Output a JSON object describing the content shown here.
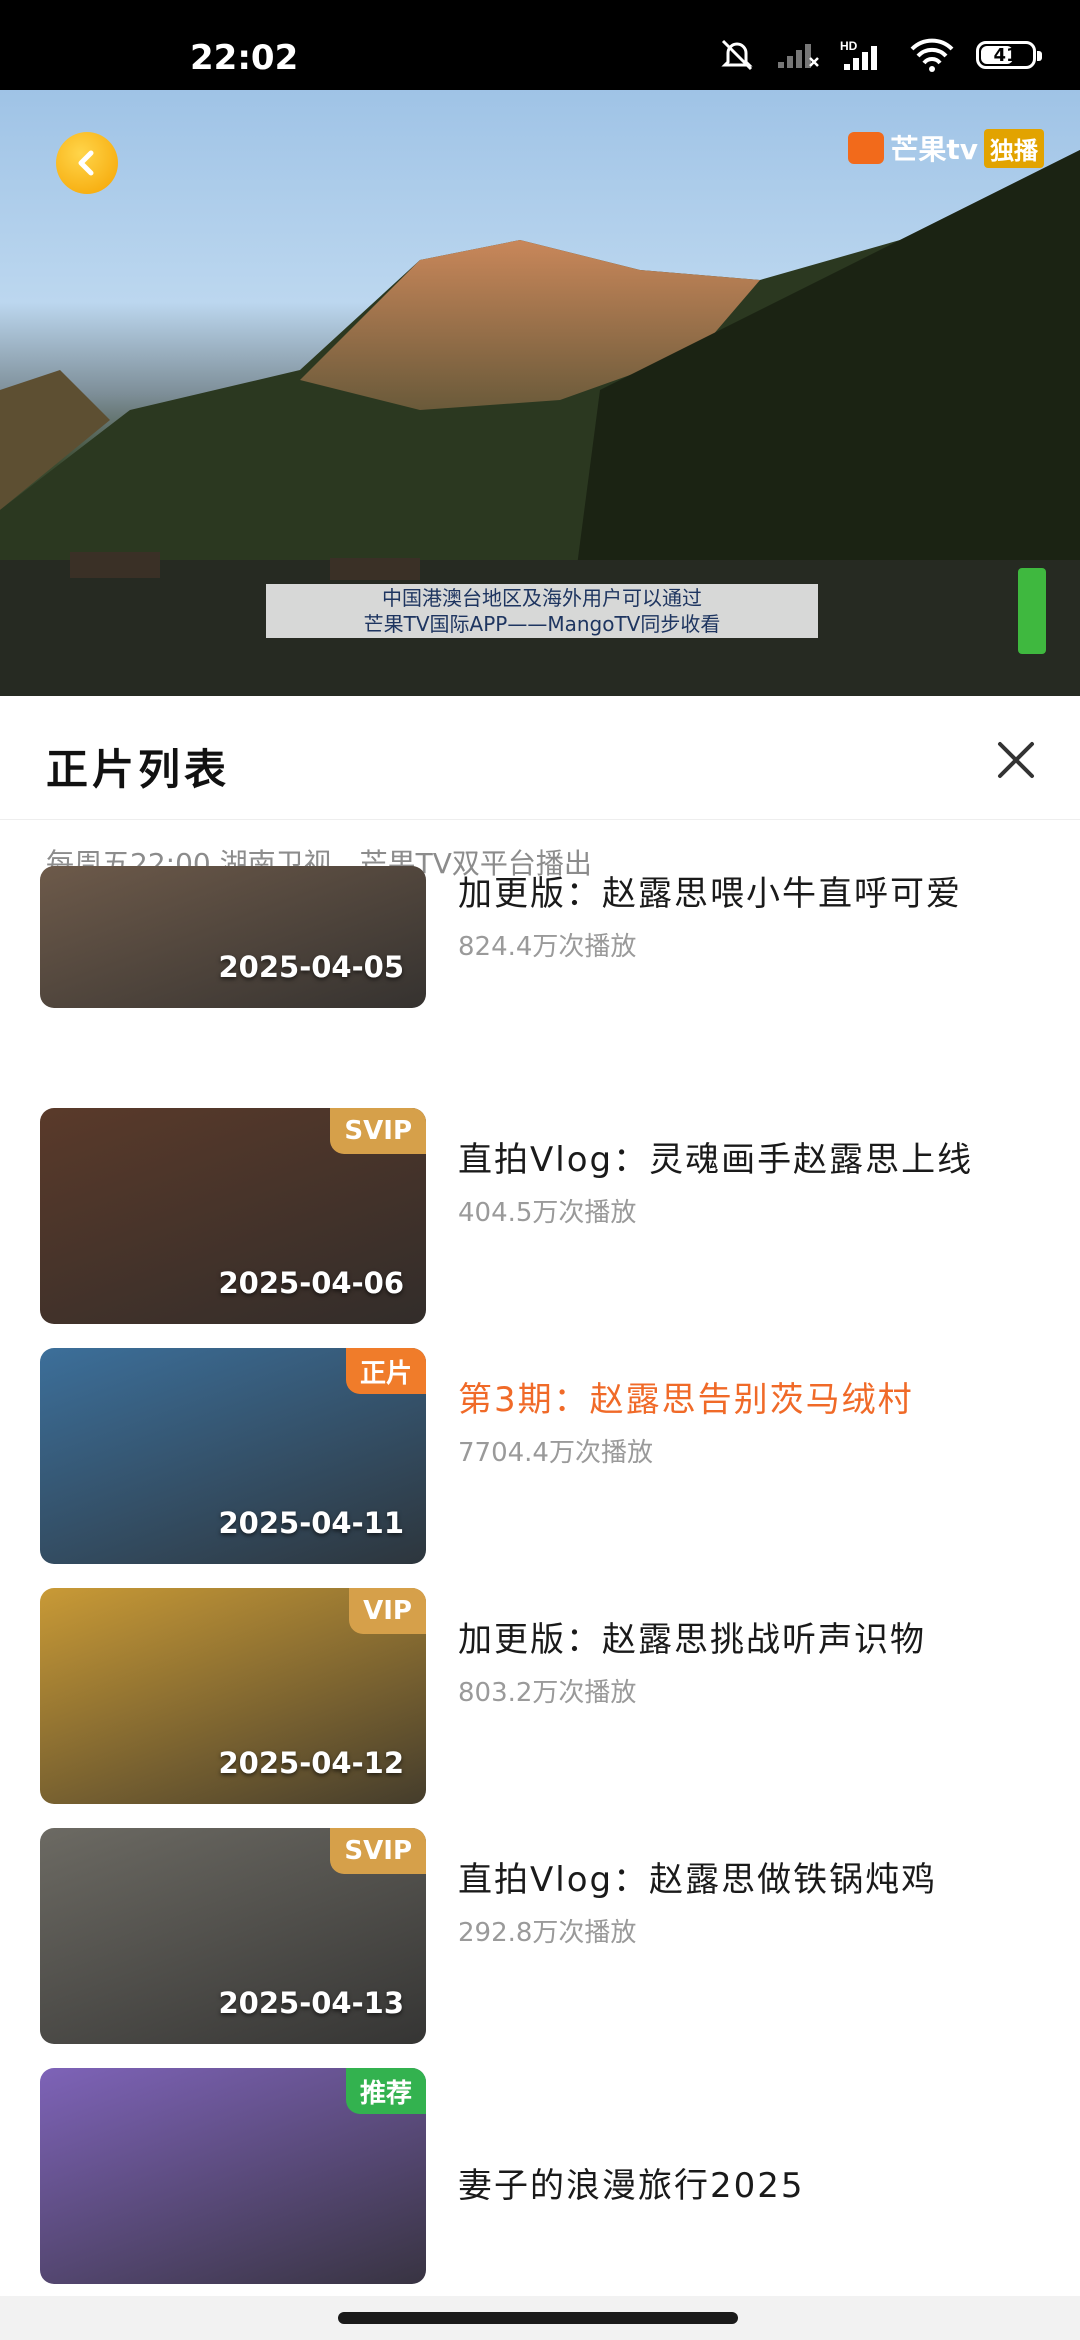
{
  "status_bar": {
    "time": "22:02",
    "network": "HD",
    "wifi_level": "6",
    "battery": "41"
  },
  "player": {
    "channel_logo": "芒果tv",
    "live_badge": "独播",
    "subtitle_line1": "中国港澳台地区及海外用户可以通过",
    "subtitle_line2": "芒果TV国际APP——MangoTV同步收看"
  },
  "sheet": {
    "title": "正片列表",
    "schedule": "每周五22:00 湖南卫视、芒果TV双平台播出"
  },
  "episodes": [
    {
      "date": "2025-04-05",
      "badge": "",
      "badge_color": "",
      "title": "加更版：赵露思喂小牛直呼可爱",
      "plays": "824.4万次播放",
      "active": false,
      "bg": "#6d5a4a"
    },
    {
      "date": "2025-04-06",
      "badge": "SVIP",
      "badge_color": "gold",
      "title": "直拍Vlog：灵魂画手赵露思上线",
      "plays": "404.5万次播放",
      "active": false,
      "bg": "#5a3a2a"
    },
    {
      "date": "2025-04-11",
      "badge": "正片",
      "badge_color": "orange",
      "title": "第3期：赵露思告别茨马绒村",
      "plays": "7704.4万次播放",
      "active": true,
      "bg": "#3c6f9a"
    },
    {
      "date": "2025-04-12",
      "badge": "VIP",
      "badge_color": "gold",
      "title": "加更版：赵露思挑战听声识物",
      "plays": "803.2万次播放",
      "active": false,
      "bg": "#c99a36"
    },
    {
      "date": "2025-04-13",
      "badge": "SVIP",
      "badge_color": "gold",
      "title": "直拍Vlog：赵露思做铁锅炖鸡",
      "plays": "292.8万次播放",
      "active": false,
      "bg": "#6c6a63"
    },
    {
      "date": "",
      "badge": "推荐",
      "badge_color": "green",
      "title": "妻子的浪漫旅行2025",
      "plays": "",
      "active": false,
      "bg": "#7e63b8"
    }
  ]
}
